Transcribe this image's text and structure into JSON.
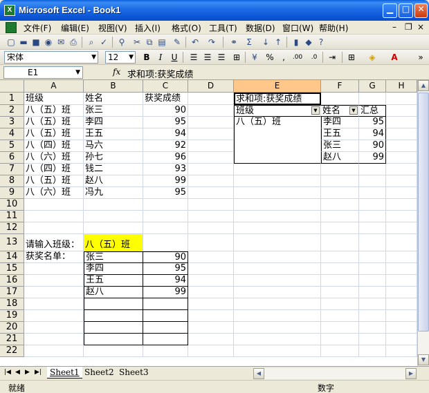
{
  "window": {
    "title": "Microsoft Excel - Book1"
  },
  "menu": [
    "文件(F)",
    "编辑(E)",
    "视图(V)",
    "插入(I)",
    "格式(O)",
    "工具(T)",
    "数据(D)",
    "窗口(W)",
    "帮助(H)"
  ],
  "format_toolbar": {
    "font_name": "宋体",
    "font_size": "12"
  },
  "formula_bar": {
    "name_box": "E1",
    "fx": "fx",
    "content": "求和项:获奖成绩"
  },
  "columns": [
    "A",
    "B",
    "C",
    "D",
    "E",
    "F",
    "G",
    "H"
  ],
  "selected_column": "E",
  "rows": [
    "1",
    "2",
    "3",
    "4",
    "5",
    "6",
    "7",
    "8",
    "9",
    "10",
    "11",
    "12",
    "13",
    "14",
    "15",
    "16",
    "17",
    "18",
    "19",
    "20",
    "21",
    "22"
  ],
  "table": {
    "headers": [
      "班级",
      "姓名",
      "获奖成绩"
    ],
    "records": [
      [
        "八（五）班",
        "张三",
        "90"
      ],
      [
        "八（五）班",
        "李四",
        "95"
      ],
      [
        "八（五）班",
        "王五",
        "94"
      ],
      [
        "八（四）班",
        "马六",
        "92"
      ],
      [
        "八（六）班",
        "孙七",
        "96"
      ],
      [
        "八（四）班",
        "钱二",
        "93"
      ],
      [
        "八（五）班",
        "赵八",
        "99"
      ],
      [
        "八（六）班",
        "冯九",
        "95"
      ]
    ]
  },
  "input": {
    "prompt": "请输入班级：",
    "value": "八（五）班",
    "list_label": "获奖名单："
  },
  "result": [
    [
      "张三",
      "90"
    ],
    [
      "李四",
      "95"
    ],
    [
      "王五",
      "94"
    ],
    [
      "赵八",
      "99"
    ]
  ],
  "pivot": {
    "data_field": "求和项:获奖成绩",
    "row_field": "班级",
    "col_field": "姓名",
    "total_label": "汇总",
    "class_value": "八（五）班",
    "items": [
      [
        "李四",
        "95"
      ],
      [
        "王五",
        "94"
      ],
      [
        "张三",
        "90"
      ],
      [
        "赵八",
        "99"
      ]
    ]
  },
  "sheets": [
    "Sheet1",
    "Sheet2",
    "Sheet3"
  ],
  "active_sheet": "Sheet1",
  "status": {
    "ready": "就绪",
    "mode": "数字"
  }
}
